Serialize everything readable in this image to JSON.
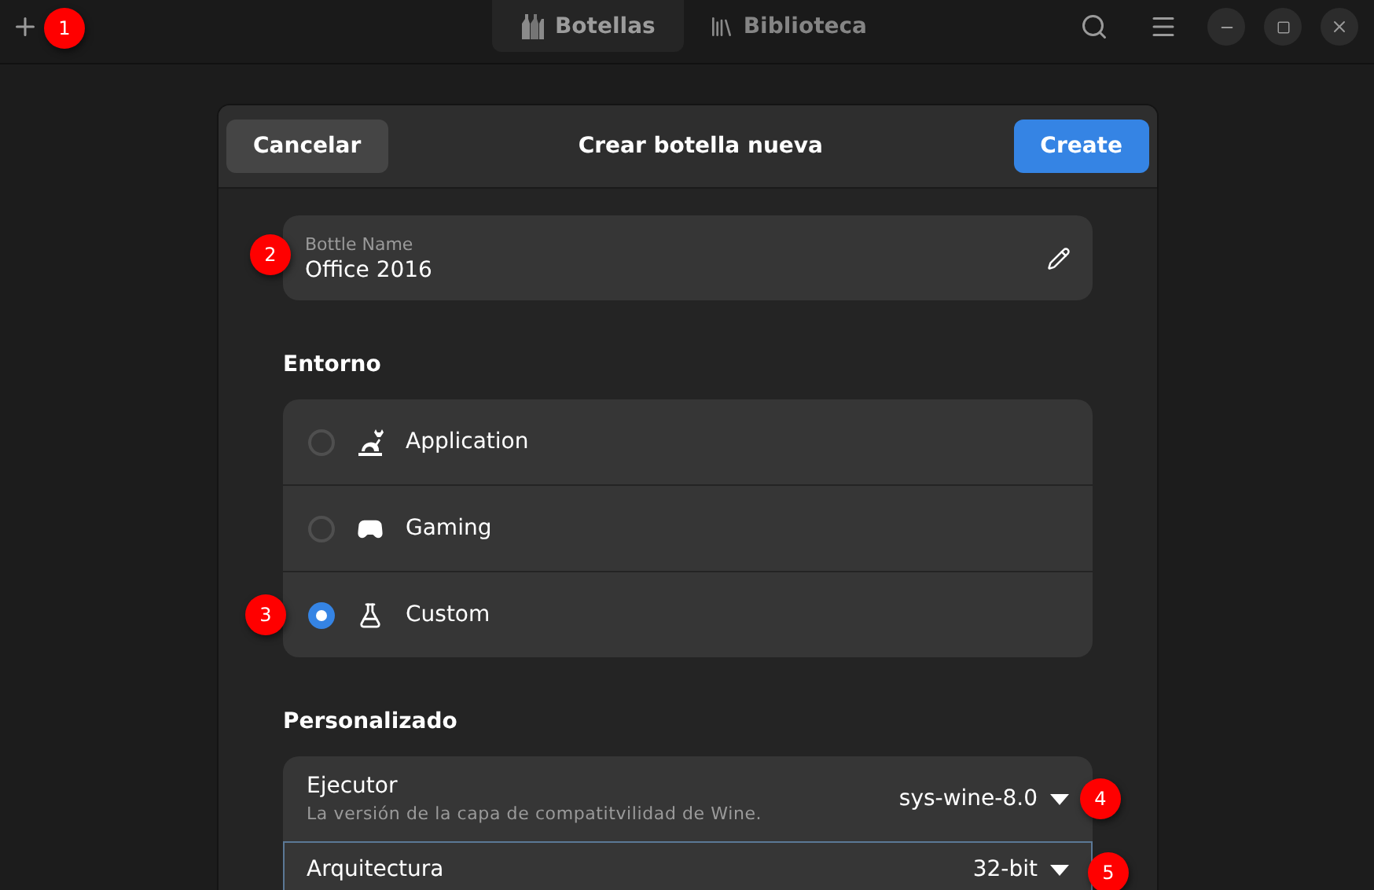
{
  "header_bar": {
    "tabs": [
      {
        "label": "Botellas",
        "kind": "bottles",
        "selected": true
      },
      {
        "label": "Biblioteca",
        "kind": "library",
        "selected": false
      }
    ]
  },
  "dialog": {
    "title": "Crear botella nueva",
    "cancel_button": "Cancelar",
    "create_button": "Create",
    "name_field": {
      "label": "Bottle Name",
      "value": "Office 2016"
    },
    "environment": {
      "heading": "Entorno",
      "options": [
        {
          "label": "Application",
          "kind": "application",
          "selected": false
        },
        {
          "label": "Gaming",
          "kind": "gaming",
          "selected": false
        },
        {
          "label": "Custom",
          "kind": "custom",
          "selected": true
        }
      ]
    },
    "custom": {
      "heading": "Personalizado",
      "rows": [
        {
          "label": "Ejecutor",
          "description": "La versión de la capa de compatitvilidad de Wine.",
          "value": "sys-wine-8.0",
          "focused": false
        },
        {
          "label": "Arquitectura",
          "value": "32-bit",
          "focused": true
        }
      ]
    }
  },
  "annotations": [
    "1",
    "2",
    "3",
    "4",
    "5"
  ]
}
